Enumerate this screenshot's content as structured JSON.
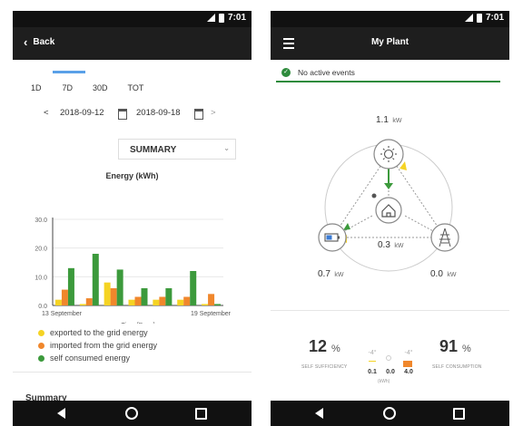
{
  "status_bar": {
    "time": "7:01"
  },
  "left_screen": {
    "back_label": "Back",
    "tabs": [
      "1D",
      "7D",
      "30D",
      "TOT"
    ],
    "date_start": "2018-09-12",
    "date_end": "2018-09-18",
    "prev_arrow": "<",
    "next_arrow": ">",
    "view_select": "SUMMARY",
    "summary_heading": "Summary"
  },
  "right_screen": {
    "title": "My Plant",
    "events_text": "No active events",
    "solar_power": "1.1",
    "home_power": "0.3",
    "battery_power": "0.7",
    "grid_power": "0.0",
    "power_unit": "kW",
    "self_sufficiency_pct": "12",
    "self_sufficiency_label": "SELF SUFFICIENCY",
    "self_consumption_pct": "91",
    "self_consumption_label": "SELF CONSUMPTION",
    "pct_unit": "%",
    "mini_values": [
      "0.1",
      "0.0",
      "4.0"
    ],
    "mini_unit": "(kWh)",
    "mini_heads": [
      "-4°",
      "-4°"
    ]
  },
  "colors": {
    "exported": "#f5d324",
    "imported": "#f0872c",
    "self_consumed": "#3c9a3c",
    "solar_arrow": "#3c9a3c",
    "accent_green": "#2e8b3c"
  },
  "chart_data": {
    "type": "bar",
    "title": "Energy (kWh)",
    "xlabel": "Time [Days]",
    "ylabel": "",
    "ylim": [
      0,
      30
    ],
    "yticks": [
      "0.0",
      "10.0",
      "20.0",
      "30.0"
    ],
    "xtick_labels": [
      "13 September",
      "19 September"
    ],
    "categories": [
      "1",
      "2",
      "3",
      "4",
      "5",
      "6",
      "7"
    ],
    "series": [
      {
        "name": "exported to the grid energy",
        "color": "#f5d324",
        "values": [
          2,
          0.5,
          8,
          2,
          2,
          2,
          0.5
        ]
      },
      {
        "name": "imported from the grid energy",
        "color": "#f0872c",
        "values": [
          5.5,
          2.5,
          6,
          3,
          3,
          3,
          4
        ]
      },
      {
        "name": "self consumed energy",
        "color": "#3c9a3c",
        "values": [
          13,
          18,
          12.5,
          6,
          6,
          12,
          0.5
        ]
      }
    ]
  }
}
